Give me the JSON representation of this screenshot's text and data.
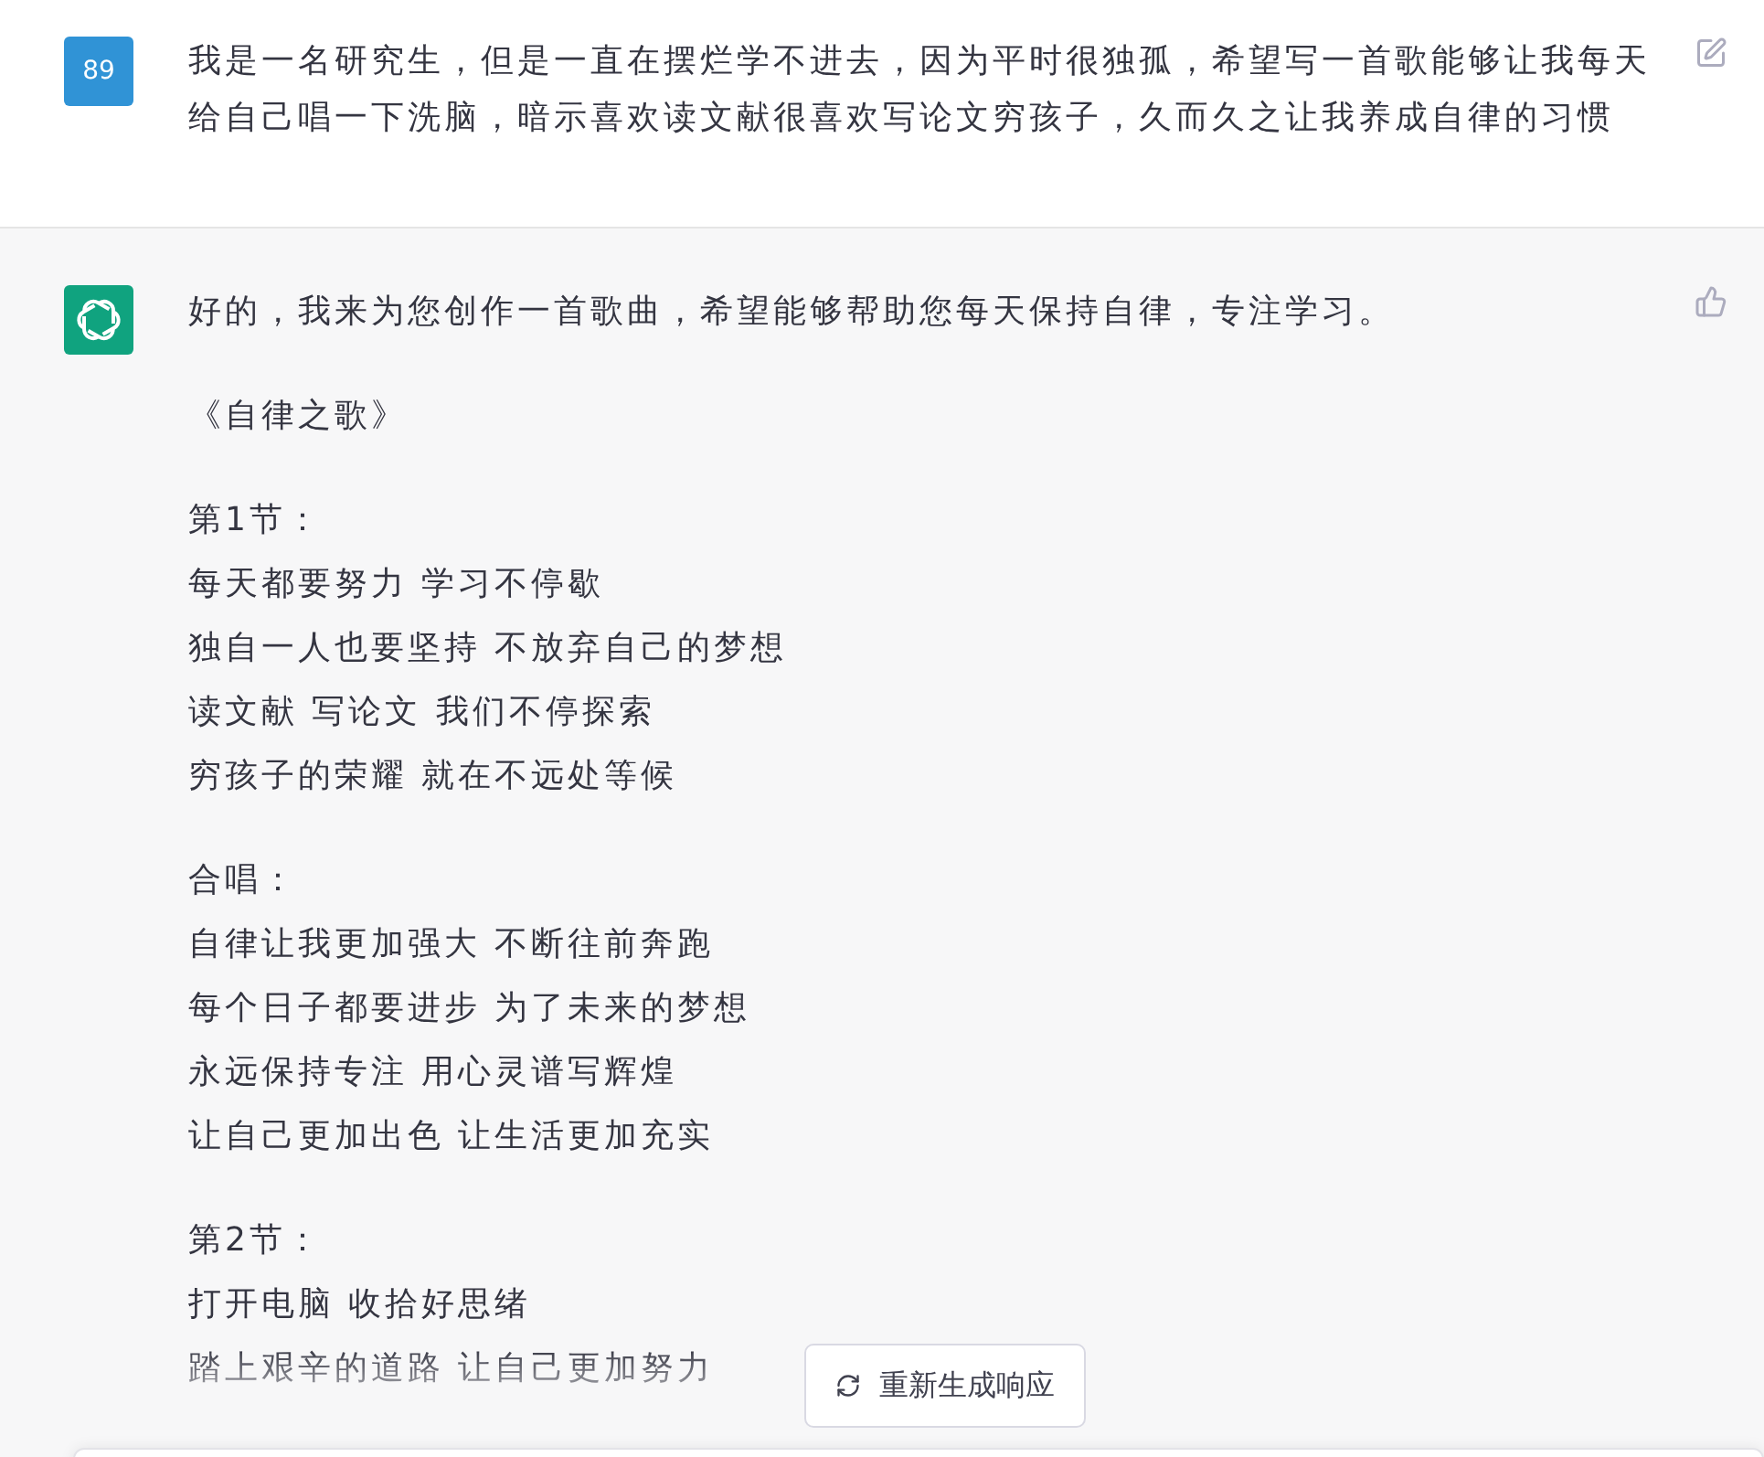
{
  "user_message": {
    "avatar": "89",
    "text": "我是一名研究生，但是一直在摆烂学不进去，因为平时很独孤，希望写一首歌能够让我每天给自己唱一下洗脑，暗示喜欢读文献很喜欢写论文穷孩子，久而久之让我养成自律的习惯"
  },
  "assistant_message": {
    "intro": "好的，我来为您创作一首歌曲，希望能够帮助您每天保持自律，专注学习。",
    "title": "《自律之歌》",
    "stanzas": [
      {
        "heading": "第1节：",
        "lines": [
          "每天都要努力 学习不停歇",
          "独自一人也要坚持 不放弃自己的梦想",
          "读文献 写论文 我们不停探索",
          "穷孩子的荣耀 就在不远处等候"
        ]
      },
      {
        "heading": "合唱：",
        "lines": [
          "自律让我更加强大 不断往前奔跑",
          "每个日子都要进步 为了未来的梦想",
          "永远保持专注 用心灵谱写辉煌",
          "让自己更加出色 让生活更加充实"
        ]
      },
      {
        "heading": "第2节：",
        "lines": [
          "打开电脑 收拾好思绪",
          "踏上艰辛的道路 让自己更加努力"
        ]
      }
    ]
  },
  "regenerate_button": "重新生成响应"
}
